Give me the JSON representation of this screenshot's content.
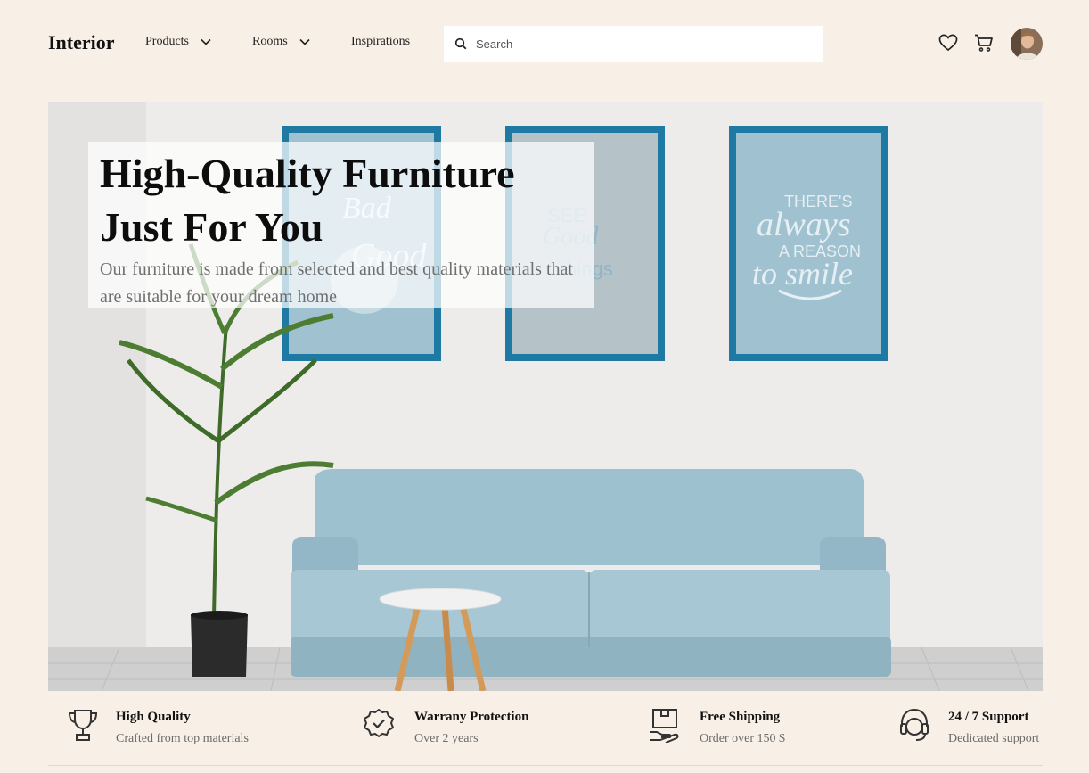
{
  "header": {
    "logo": "Interior",
    "nav": [
      {
        "label": "Products"
      },
      {
        "label": "Rooms"
      },
      {
        "label": "Inspirations"
      }
    ],
    "search": {
      "placeholder": "Search"
    },
    "icons": [
      "heart-icon",
      "cart-icon",
      "avatar"
    ]
  },
  "hero": {
    "title_line1": "High-Quality Furniture",
    "title_line2": "Just For You",
    "subtitle": "Our furniture is made from selected and best quality materials that are suitable for your dream home",
    "frames": [
      {
        "text": "Bad Good"
      },
      {
        "text": "See Good Things"
      },
      {
        "text": "There's always a reason to smile"
      }
    ]
  },
  "features": [
    {
      "icon": "trophy-icon",
      "title": "High Quality",
      "subtitle": "Crafted from top materials"
    },
    {
      "icon": "badge-check-icon",
      "title": "Warrany Protection",
      "subtitle": "Over 2 years"
    },
    {
      "icon": "package-hand-icon",
      "title": "Free Shipping",
      "subtitle": "Order over 150 $"
    },
    {
      "icon": "headset-icon",
      "title": "24 / 7 Support",
      "subtitle": "Dedicated support"
    }
  ],
  "colors": {
    "background": "#f8efe6",
    "frame_blue": "#1f7aa3",
    "sofa_blue": "#9ec1cf"
  }
}
